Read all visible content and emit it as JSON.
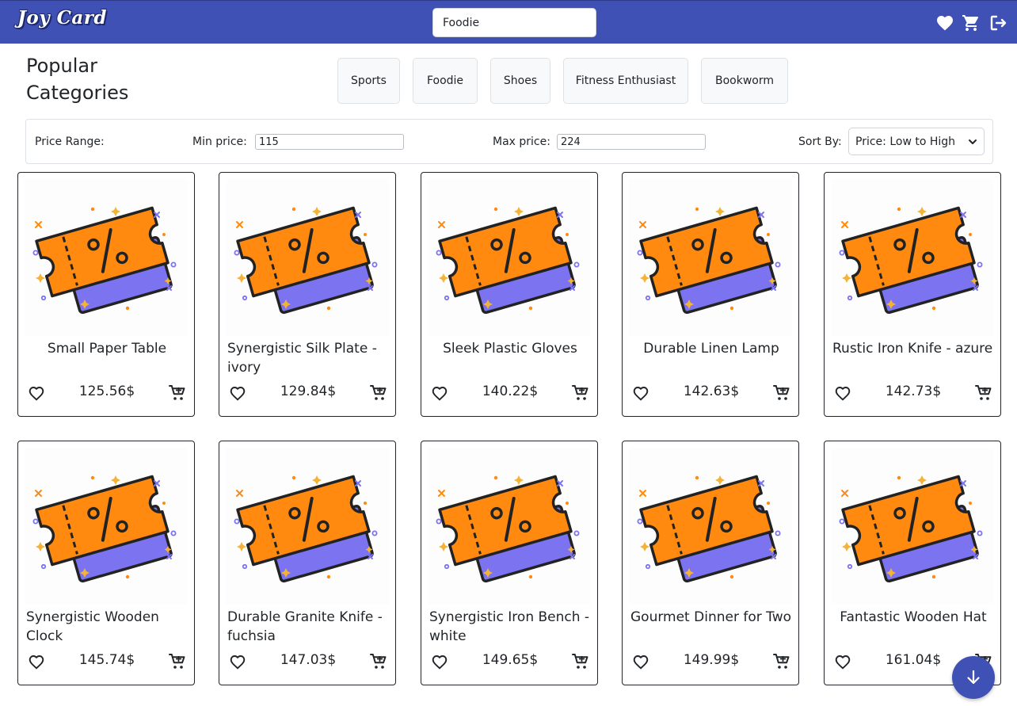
{
  "header": {
    "logo": "Joy Card",
    "search_value": "Foodie",
    "icons": [
      "heart-icon",
      "cart-icon",
      "logout-icon"
    ]
  },
  "categories": {
    "title": "Popular Categories",
    "items": [
      "Sports",
      "Foodie",
      "Shoes",
      "Fitness Enthusiast",
      "Bookworm"
    ]
  },
  "filter": {
    "price_range_label": "Price Range:",
    "min_label": "Min price:",
    "min_value": "115",
    "max_label": "Max price:",
    "max_value": "224",
    "sort_label": "Sort By:",
    "sort_value": "Price: Low to High"
  },
  "products": [
    {
      "name": "Small Paper Table",
      "price": "125.56$"
    },
    {
      "name": "Synergistic Silk Plate - ivory",
      "price": "129.84$"
    },
    {
      "name": "Sleek Plastic Gloves",
      "price": "140.22$"
    },
    {
      "name": "Durable Linen Lamp",
      "price": "142.63$"
    },
    {
      "name": "Rustic Iron Knife - azure",
      "price": "142.73$"
    },
    {
      "name": "Synergistic Wooden Clock",
      "price": "145.74$"
    },
    {
      "name": "Durable Granite Knife - fuchsia",
      "price": "147.03$"
    },
    {
      "name": "Synergistic Iron Bench - white",
      "price": "149.65$"
    },
    {
      "name": "Gourmet Dinner for Two",
      "price": "149.99$"
    },
    {
      "name": "Fantastic Wooden Hat",
      "price": "161.04$"
    }
  ],
  "colors": {
    "brand": "#3f51b5",
    "ticket_front": "#ff8a0f",
    "ticket_back": "#7b73f0"
  }
}
